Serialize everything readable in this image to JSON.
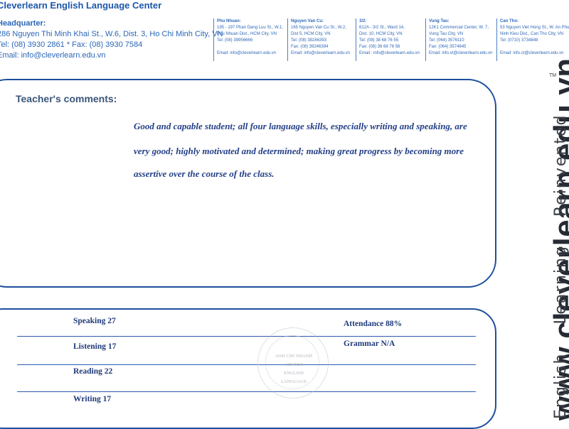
{
  "header": {
    "center_name": "Cleverlearn English Language Center",
    "hq_title": "Headquarter:",
    "hq_address": "286 Nguyen Thi Minh Khai St., W.6, Dist. 3, Ho Chi Minh City, VN",
    "hq_phone": "Tel: (08) 3930 2861 * Fax: (08) 3930 7584",
    "hq_email": "Email: info@cleverlearn.edu.vn"
  },
  "branches": [
    {
      "name": "Phu Nhuan:",
      "lines": [
        "195 - 197 Phan Dang Luu St., W.1,",
        "Phu Nhuan Dist., HCM City, VN",
        "Tel: (08) 39956666",
        "",
        "Email: info@cleverlearn.edu.vn"
      ]
    },
    {
      "name": "Nguyen Van Cu:",
      "lines": [
        "165 Nguyen Van Cu St., W.2,",
        "Dist 5, HCM City, VN",
        "Tel: (08) 39246393",
        "Fax: (08) 39246394",
        "Email: info@cleverlearn.edu.vn"
      ]
    },
    {
      "name": "3/2:",
      "lines": [
        "612A - 3/2 St., Ward 14,",
        "Dist. 10, HCM City, VN",
        "Tel: (08) 38 68 76 55",
        "Fax: (08) 38 68 76 56",
        "Email : info@cleverlearn.edu.vn"
      ]
    },
    {
      "name": "Vung Tau:",
      "lines": [
        "12K1 Commercial Center, W. 7,",
        "Vung Tau City, VN",
        "Tel: (064) 3576110",
        "Fax: (064) 3574645",
        "Email: info.vt@cleverlearn.edu.vn"
      ]
    },
    {
      "name": "Can Tho:",
      "lines": [
        "53 Nguyen Viet Hong St., W. An Phu,",
        "Ninh Kieu Dist., Can Tho City, VN",
        "Tel: (0710) 3734848",
        "",
        "Email: info.ct@cleverlearn.edu.vn"
      ]
    }
  ],
  "comments": {
    "heading": "Teacher's comments:",
    "lines": [
      "Good and capable student; all four language skills, especially writing and speaking, are",
      "very good; highly motivated and determined; making great progress by becoming more",
      "assertive over the course of the class."
    ]
  },
  "scores": {
    "speaking": "Speaking  27",
    "listening": "Listening  17",
    "reading": "Reading  22",
    "writing": "Writing  17",
    "attendance": "Attendance  88%",
    "grammar": "Grammar  N/A"
  },
  "stamp": {
    "lines": [
      "ANH CHI NHANH",
      "CENTER",
      "ENGLISH",
      "LANGUAGE"
    ]
  },
  "branding": {
    "url": "www.cleverlearn.edu.vn",
    "tagline_1": "English",
    "tagline_2": "Learning",
    "tagline_3": "Reinvented",
    "trademark": "TM"
  }
}
